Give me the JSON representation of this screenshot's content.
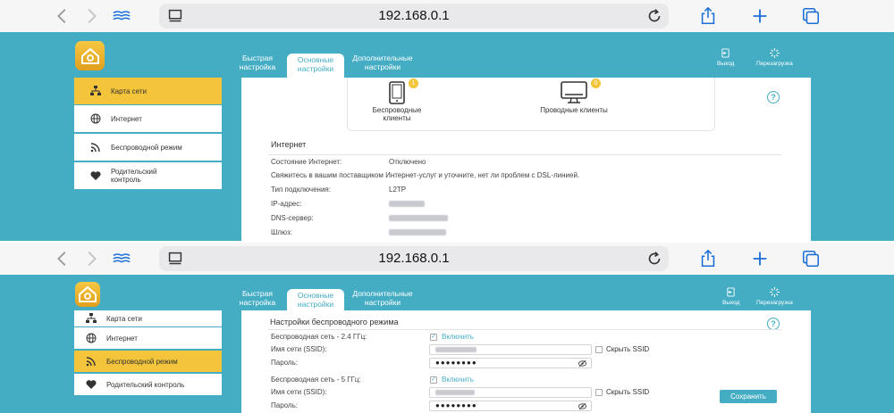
{
  "browser": {
    "url": "192.168.0.1",
    "icons": [
      "back-icon",
      "forward-icon",
      "reader-icon",
      "tab-list-icon",
      "reload-icon",
      "share-icon",
      "new-tab-icon",
      "tabs-icon"
    ]
  },
  "colors": {
    "accent": "#44adc4",
    "active": "#f4c53b",
    "brand": "#e8aa25"
  },
  "tabs": [
    {
      "label": "Быстрая настройка"
    },
    {
      "label": "Основные настройки"
    },
    {
      "label": "Дополнительные настройки"
    }
  ],
  "toolbar": {
    "logout_label": "Выход",
    "reboot_label": "Перезагрузка"
  },
  "sidebar": {
    "items": [
      {
        "label": "Карта сети",
        "icon": "network-map-icon"
      },
      {
        "label": "Интернет",
        "icon": "globe-icon"
      },
      {
        "label": "Беспроводной режим",
        "icon": "wifi-icon"
      },
      {
        "label": "Родительский контроль",
        "icon": "heart-icon"
      }
    ]
  },
  "network_map": {
    "wireless_clients": {
      "label": "Беспроводные клиенты",
      "count": "1"
    },
    "wired_clients": {
      "label": "Проводные клиенты",
      "count": "0"
    }
  },
  "internet": {
    "title": "Интернет",
    "status_label": "Состояние Интернет:",
    "status_value": "Отключено",
    "message": "Свяжитесь в вашим поставщиком Интернет-услуг и уточните, нет ли проблем с DSL-линией.",
    "conn_type_label": "Тип подключения:",
    "conn_type_value": "L2TP",
    "ip_label": "IP-адрес:",
    "dns_label": "DNS-сервер:",
    "gateway_label": "Шлюз:"
  },
  "wireless": {
    "title": "Настройки беспроводного режима",
    "band24_label": "Беспроводная сеть - 2.4 ГГц:",
    "band5_label": "Беспроводная сеть - 5 ГГц:",
    "enable_label": "Включить",
    "ssid_label": "Имя сети (SSID):",
    "password_label": "Пароль:",
    "hide_ssid_label": "Скрыть SSID",
    "password_mask": "●●●●●●●●",
    "save_label": "Сохранить"
  }
}
